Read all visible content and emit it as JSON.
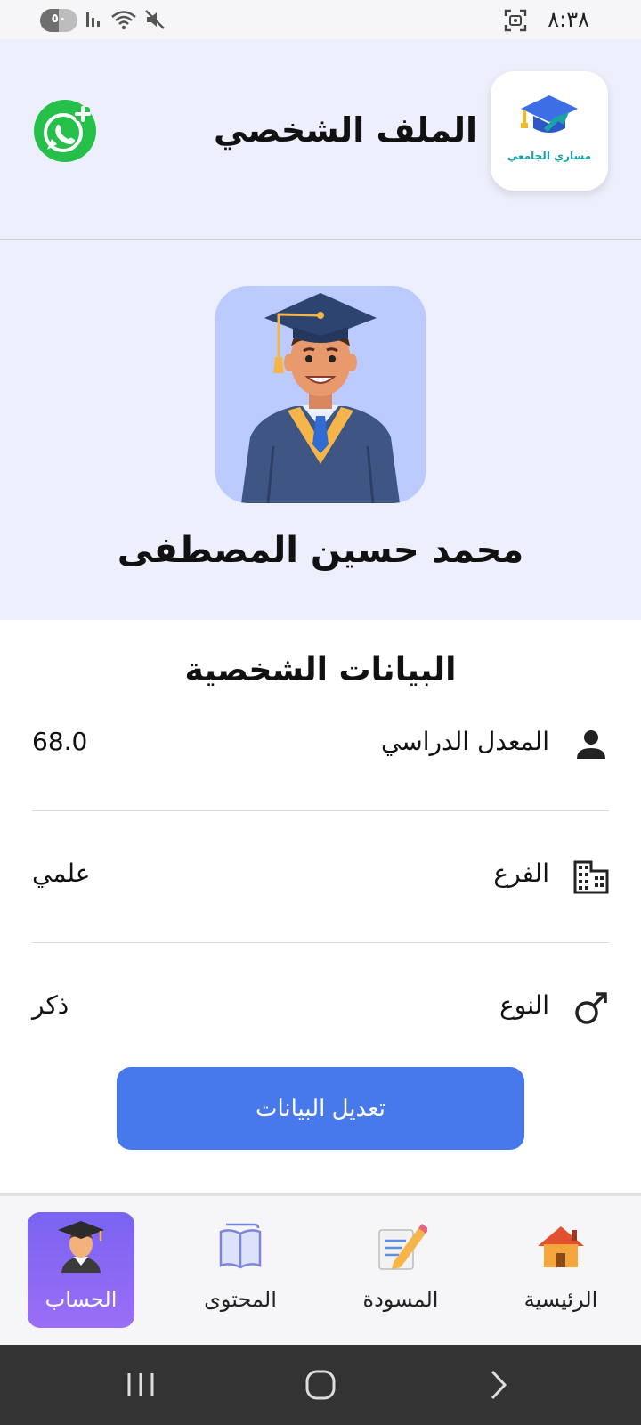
{
  "status_bar": {
    "time": "٨:٣٨",
    "battery": "٥٠"
  },
  "header": {
    "title": "الملف الشخصي",
    "logo_text": "مساري الجامعي"
  },
  "profile": {
    "name": "محمد حسين المصطفى"
  },
  "personal_data": {
    "title": "البيانات الشخصية",
    "rows": [
      {
        "label": "المعدل الدراسي",
        "value": "68.0",
        "icon": "person-icon"
      },
      {
        "label": "الفرع",
        "value": "علمي",
        "icon": "building-icon"
      },
      {
        "label": "النوع",
        "value": "ذكر",
        "icon": "male-icon"
      }
    ]
  },
  "edit_button": {
    "label": "تعديل البيانات"
  },
  "bottom_nav": {
    "items": [
      {
        "label": "الرئيسية",
        "icon": "house-icon"
      },
      {
        "label": "المسودة",
        "icon": "memo-pencil-icon"
      },
      {
        "label": "المحتوى",
        "icon": "book-icon"
      },
      {
        "label": "الحساب",
        "icon": "graduate-icon",
        "active": true
      }
    ]
  },
  "colors": {
    "header_bg": "#edf0fc",
    "avatar_bg": "#bccbfd",
    "primary_button": "#4779ed",
    "active_tab": "#8a66f3",
    "whatsapp_green": "#25c04a",
    "system_nav": "#333333"
  }
}
